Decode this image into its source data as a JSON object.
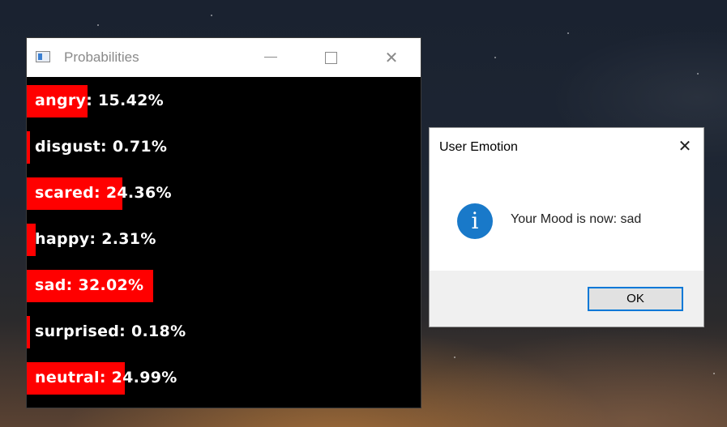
{
  "probabilities_window": {
    "title": "Probabilities",
    "controls": {
      "minimize": "minimize",
      "maximize": "maximize",
      "close": "✕"
    },
    "rows": [
      {
        "label": "angry: 15.42%",
        "value": 15.42
      },
      {
        "label": "disgust: 0.71%",
        "value": 0.71
      },
      {
        "label": "scared: 24.36%",
        "value": 24.36
      },
      {
        "label": "happy: 2.31%",
        "value": 2.31
      },
      {
        "label": "sad: 32.02%",
        "value": 32.02
      },
      {
        "label": "surprised: 0.18%",
        "value": 0.18
      },
      {
        "label": "neutral: 24.99%",
        "value": 24.99
      }
    ],
    "colors": {
      "bar": "#ff0000",
      "background": "#000000",
      "text": "#ffffff"
    }
  },
  "message_box": {
    "title": "User Emotion",
    "close": "✕",
    "icon": "info-icon",
    "icon_glyph": "i",
    "message": "Your Mood is now: sad",
    "ok_label": "OK",
    "colors": {
      "accent": "#0078d7",
      "icon": "#1979c9"
    }
  }
}
